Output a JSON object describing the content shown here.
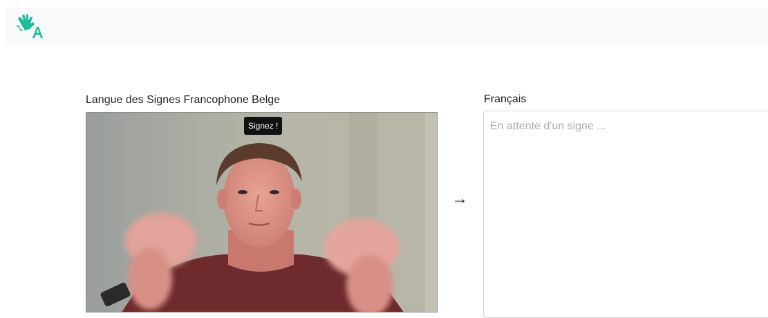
{
  "navbar": {
    "logo_icon": "hand-sign-letter-a-icon",
    "accent_color": "#1abc9c"
  },
  "source": {
    "label": "Langue des Signes Francophone Belge",
    "tooltip": "Signez !"
  },
  "arrow": "→",
  "target": {
    "label": "Français",
    "placeholder": "En attente d'un signe ..."
  }
}
